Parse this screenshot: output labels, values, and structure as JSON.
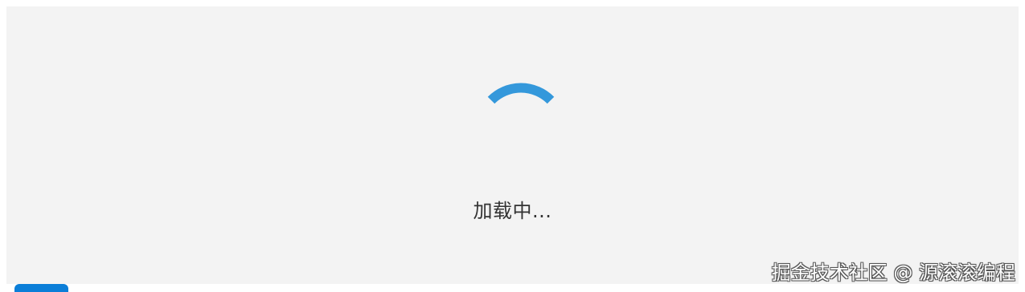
{
  "loading": {
    "text": "加载中...",
    "spinner_color": "#3498db",
    "panel_background": "#f3f3f3"
  },
  "watermark": {
    "text": "掘金技术社区 @ 源滚滚编程"
  },
  "bottom_tab": {
    "color": "#0b7ed8"
  }
}
